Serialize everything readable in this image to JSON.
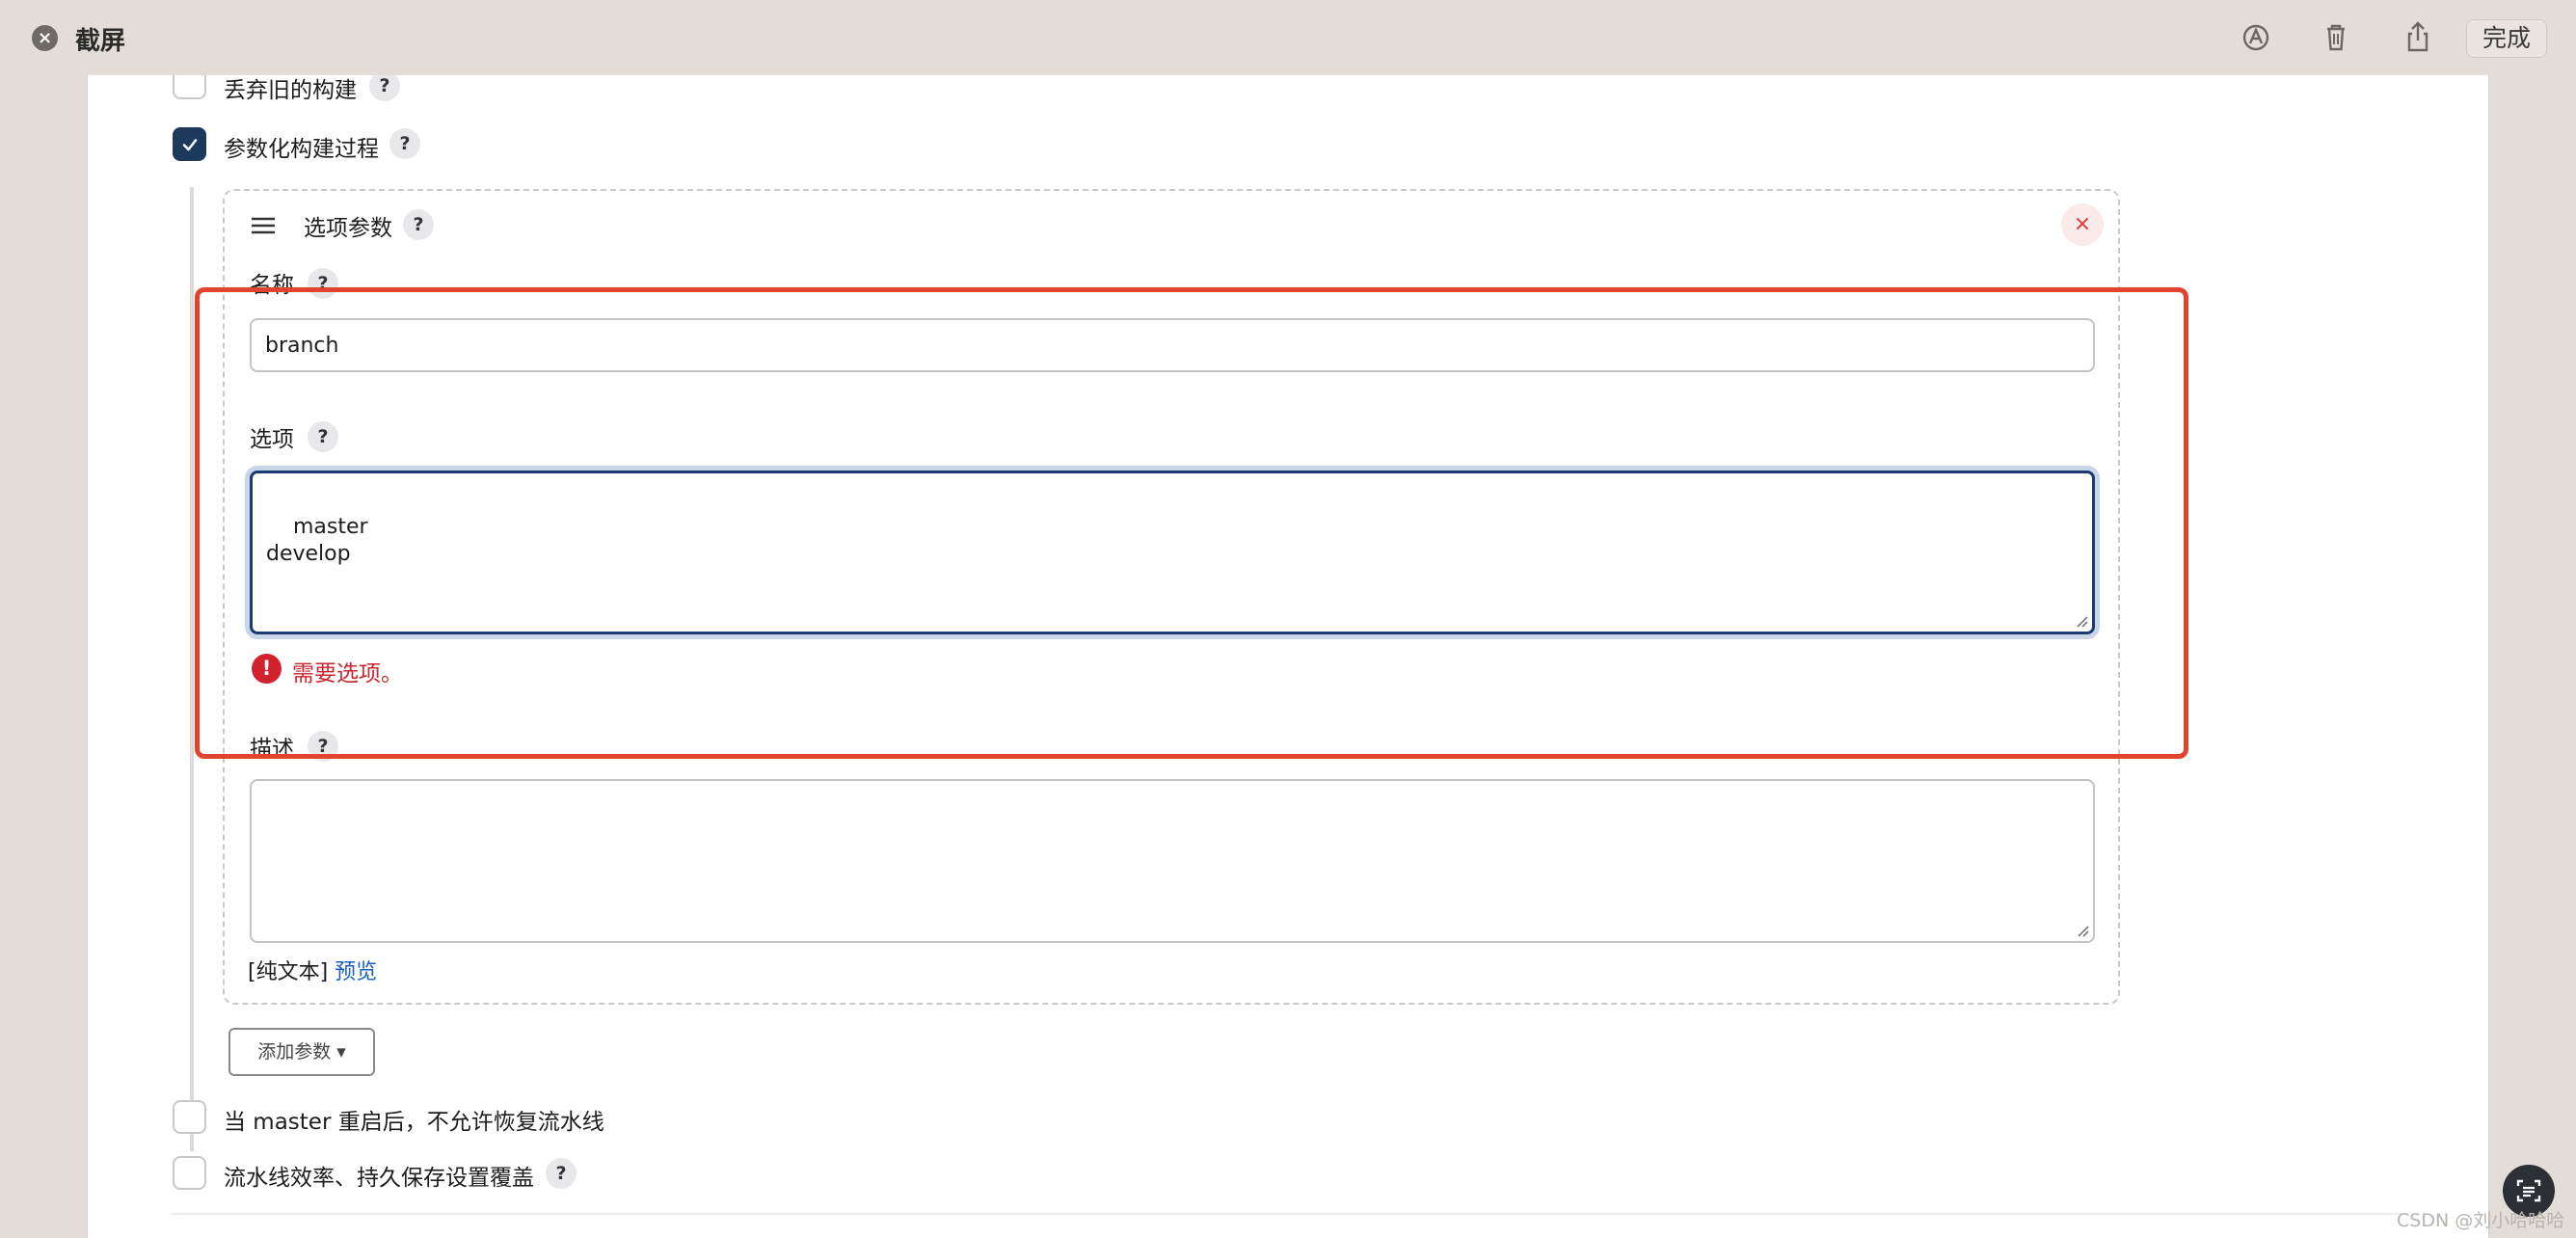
{
  "window": {
    "title": "截屏",
    "done_label": "完成"
  },
  "toolbar_icons": [
    "markup-icon",
    "trash-icon",
    "share-icon"
  ],
  "options": {
    "discard_old_builds": {
      "label": "丢弃旧的构建",
      "checked": false
    },
    "parameterized": {
      "label": "参数化构建过程",
      "checked": true
    },
    "no_resume": {
      "label": "当 master 重启后，不允许恢复流水线",
      "checked": false
    },
    "durability_override": {
      "label": "流水线效率、持久保存设置覆盖",
      "checked": false
    }
  },
  "help_glyph": "?",
  "choice_parameter": {
    "title": "选项参数",
    "delete_glyph": "×",
    "name_label": "名称",
    "name_value": "branch",
    "choices_label": "选项",
    "choices_value": "master\ndevelop",
    "error_glyph": "!",
    "error_text": "需要选项。",
    "description_label": "描述",
    "description_value": "",
    "markup_prefix": "[纯文本]",
    "preview_link": "预览"
  },
  "add_parameter_label": "添加参数 ▾",
  "watermark": "CSDN @刘小哈哈哈",
  "colors": {
    "checkbox_checked": "#1d3a5c",
    "error": "#c8252e",
    "highlight": "#e0442d",
    "link": "#1c5fbf"
  }
}
